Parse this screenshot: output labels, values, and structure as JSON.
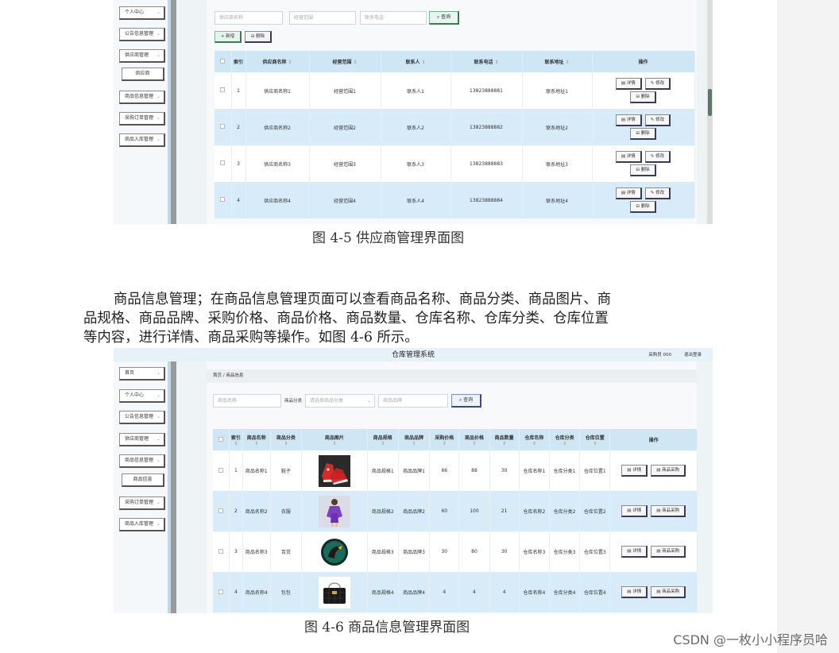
{
  "fig1": {
    "sidebar": [
      {
        "label": "个人中心"
      },
      {
        "label": "公告信息管理"
      },
      {
        "label": "供应商管理"
      },
      {
        "label": "供应商",
        "sub": true
      },
      {
        "label": "商品信息管理"
      },
      {
        "label": "采购订单管理"
      },
      {
        "label": "商品入库管理"
      }
    ],
    "search": {
      "name_ph": "供应商名称",
      "scope_ph": "经营范围",
      "phone_ph": "联系电话",
      "query": "查询"
    },
    "actions": {
      "add": "新增",
      "del": "删除"
    },
    "headers": [
      "索引",
      "供应商名称",
      "经营范围",
      "联系人",
      "联系电话",
      "联系地址",
      "操作"
    ],
    "rows": [
      {
        "idx": "1",
        "name": "供应商名称1",
        "scope": "经营范围1",
        "contact": "联系人1",
        "phone": "13823888881",
        "addr": "联系地址1"
      },
      {
        "idx": "2",
        "name": "供应商名称2",
        "scope": "经营范围2",
        "contact": "联系人2",
        "phone": "13823888882",
        "addr": "联系地址2"
      },
      {
        "idx": "3",
        "name": "供应商名称3",
        "scope": "经营范围3",
        "contact": "联系人3",
        "phone": "13823888883",
        "addr": "联系地址3"
      },
      {
        "idx": "4",
        "name": "供应商名称4",
        "scope": "经营范围4",
        "contact": "联系人4",
        "phone": "13823888884",
        "addr": "联系地址4"
      }
    ],
    "op_detail": "详情",
    "op_edit": "修改",
    "op_del": "删除",
    "caption": "图 4-5 供应商管理界面图"
  },
  "para": [
    "商品信息管理；在商品信息管理页面可以查看商品名称、商品分类、商品图片、商",
    "品规格、商品品牌、采购价格、商品价格、商品数量、仓库名称、仓库分类、仓库位置",
    "等内容，进行详情、商品采购等操作。如图 4-6 所示。"
  ],
  "fig2": {
    "title": "仓库管理系统",
    "user": "采购员 000",
    "logout": "退出登录",
    "breadcrumb": "首页 / 商品信息",
    "sidebar": [
      {
        "label": "首页"
      },
      {
        "label": "个人中心"
      },
      {
        "label": "公告信息管理"
      },
      {
        "label": "供应商管理"
      },
      {
        "label": "商品信息管理"
      },
      {
        "label": "商品信息",
        "sub": true
      },
      {
        "label": "采购订单管理"
      },
      {
        "label": "商品入库管理"
      }
    ],
    "search": {
      "name_ph": "商品名称",
      "cat_label": "商品分类",
      "cat_ph": "请选择商品分类",
      "brand_ph": "商品品牌",
      "query": "查询"
    },
    "headers": [
      "索引",
      "商品名称",
      "商品分类",
      "商品图片",
      "商品规格",
      "商品品牌",
      "采购价格",
      "商品价格",
      "商品数量",
      "仓库名称",
      "仓库分类",
      "仓库位置",
      "操作"
    ],
    "rows": [
      {
        "idx": "1",
        "name": "商品名称1",
        "cat": "鞋子",
        "img": "shoe",
        "spec": "商品规格1",
        "brand": "商品品牌1",
        "buy": "66",
        "price": "88",
        "qty": "30",
        "wh": "仓库名称1",
        "whcat": "仓库分类1",
        "pos": "仓库位置1"
      },
      {
        "idx": "2",
        "name": "商品名称2",
        "cat": "衣服",
        "img": "dress",
        "spec": "商品规格2",
        "brand": "商品品牌2",
        "buy": "60",
        "price": "100",
        "qty": "21",
        "wh": "仓库名称2",
        "whcat": "仓库分类2",
        "pos": "仓库位置2"
      },
      {
        "idx": "3",
        "name": "商品名称3",
        "cat": "百货",
        "img": "round",
        "spec": "商品规格3",
        "brand": "商品品牌3",
        "buy": "30",
        "price": "80",
        "qty": "30",
        "wh": "仓库名称3",
        "whcat": "仓库分类3",
        "pos": "仓库位置3"
      },
      {
        "idx": "4",
        "name": "商品名称4",
        "cat": "包包",
        "img": "bag",
        "spec": "商品规格4",
        "brand": "商品品牌4",
        "buy": "4",
        "price": "4",
        "qty": "4",
        "wh": "仓库名称4",
        "whcat": "仓库分类4",
        "pos": "仓库位置4"
      }
    ],
    "op_detail": "详情",
    "op_buy": "商品采购",
    "caption": "图 4-6 商品信息管理界面图"
  },
  "watermark": "CSDN @一枚小小程序员哈"
}
